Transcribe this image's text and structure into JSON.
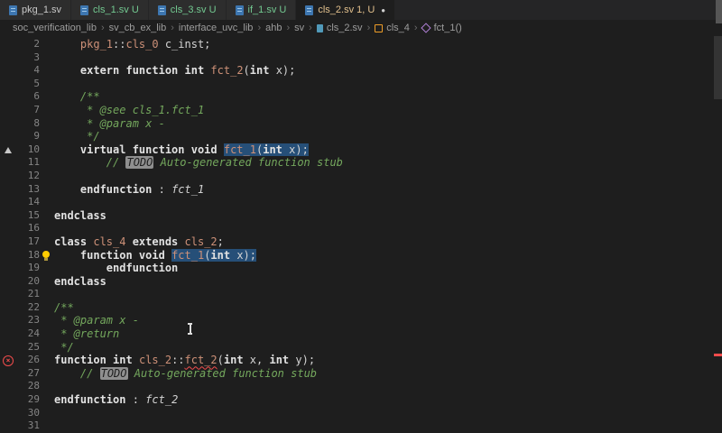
{
  "colors": {
    "editor_background": "#1e1e1e",
    "selection": "#264f78",
    "error": "#f14c4c",
    "lightbulb": "#ffcc00",
    "git_untracked": "#73c991",
    "git_modified": "#e2c08d",
    "type_token": "#ce9178",
    "comment_token": "#74a85d",
    "line_number": "#858585"
  },
  "tabs": [
    {
      "label": "pkg_1.sv",
      "decoration": "",
      "state": "plain",
      "active": false,
      "dirty": false
    },
    {
      "label": "cls_1.sv",
      "decoration": "U",
      "state": "untracked",
      "active": false,
      "dirty": false
    },
    {
      "label": "cls_3.sv",
      "decoration": "U",
      "state": "untracked",
      "active": false,
      "dirty": false
    },
    {
      "label": "if_1.sv",
      "decoration": "U",
      "state": "untracked",
      "active": false,
      "dirty": false
    },
    {
      "label": "cls_2.sv",
      "decoration": "1, U",
      "state": "modified",
      "active": true,
      "dirty": true
    }
  ],
  "breadcrumb": [
    {
      "label": "soc_verification_lib"
    },
    {
      "label": "sv_cb_ex_lib"
    },
    {
      "label": "interface_uvc_lib"
    },
    {
      "label": "ahb"
    },
    {
      "label": "sv"
    },
    {
      "label": "cls_2.sv",
      "icon": "file"
    },
    {
      "label": "cls_4",
      "icon": "class"
    },
    {
      "label": "fct_1()",
      "icon": "method"
    }
  ],
  "editor": {
    "lines": [
      {
        "num": 2,
        "segs": [
          {
            "t": "    ",
            "s": "plain"
          },
          {
            "t": "pkg_1",
            "s": "type"
          },
          {
            "t": "::",
            "s": "plain"
          },
          {
            "t": "cls_0",
            "s": "type"
          },
          {
            "t": " c_inst;",
            "s": "plain"
          }
        ]
      },
      {
        "num": 3,
        "segs": []
      },
      {
        "num": 4,
        "segs": [
          {
            "t": "    ",
            "s": "plain"
          },
          {
            "t": "extern function int",
            "s": "kw"
          },
          {
            "t": " ",
            "s": "plain"
          },
          {
            "t": "fct_2",
            "s": "type"
          },
          {
            "t": "(",
            "s": "plain"
          },
          {
            "t": "int",
            "s": "kw"
          },
          {
            "t": " x);",
            "s": "plain"
          }
        ]
      },
      {
        "num": 5,
        "segs": []
      },
      {
        "num": 6,
        "segs": [
          {
            "t": "    /**",
            "s": "cmt"
          }
        ]
      },
      {
        "num": 7,
        "segs": [
          {
            "t": "     * @see cls_1.fct_1",
            "s": "cmt"
          }
        ]
      },
      {
        "num": 8,
        "segs": [
          {
            "t": "     * @param x -",
            "s": "cmt"
          }
        ]
      },
      {
        "num": 9,
        "segs": [
          {
            "t": "     */",
            "s": "cmt"
          }
        ]
      },
      {
        "num": 10,
        "icon": "triangle",
        "segs": [
          {
            "t": "    ",
            "s": "plain"
          },
          {
            "t": "virtual function void",
            "s": "kw"
          },
          {
            "t": " ",
            "s": "plain"
          },
          {
            "t": "fct_1",
            "s": "type sel"
          },
          {
            "t": "(",
            "s": "plain sel"
          },
          {
            "t": "int",
            "s": "kw sel"
          },
          {
            "t": " x);",
            "s": "plain sel"
          }
        ]
      },
      {
        "num": 11,
        "segs": [
          {
            "t": "        ",
            "s": "plain"
          },
          {
            "t": "// ",
            "s": "cmt"
          },
          {
            "t": "TODO",
            "s": "todo"
          },
          {
            "t": " Auto-generated function stub",
            "s": "cmt"
          }
        ]
      },
      {
        "num": 12,
        "segs": []
      },
      {
        "num": 13,
        "segs": [
          {
            "t": "    ",
            "s": "plain"
          },
          {
            "t": "endfunction",
            "s": "kw"
          },
          {
            "t": " : ",
            "s": "plain"
          },
          {
            "t": "fct_1",
            "s": "lbl"
          }
        ]
      },
      {
        "num": 14,
        "segs": []
      },
      {
        "num": 15,
        "segs": [
          {
            "t": "endclass",
            "s": "kw"
          }
        ]
      },
      {
        "num": 16,
        "segs": []
      },
      {
        "num": 17,
        "segs": [
          {
            "t": "class ",
            "s": "kw"
          },
          {
            "t": "cls_4",
            "s": "type"
          },
          {
            "t": " extends ",
            "s": "kw"
          },
          {
            "t": "cls_2",
            "s": "type"
          },
          {
            "t": ";",
            "s": "plain"
          }
        ]
      },
      {
        "num": 18,
        "icon": "bulb",
        "segs": [
          {
            "t": "    ",
            "s": "plain"
          },
          {
            "t": "function void",
            "s": "kw"
          },
          {
            "t": " ",
            "s": "plain"
          },
          {
            "t": "fct_1",
            "s": "type sel"
          },
          {
            "t": "(",
            "s": "plain sel"
          },
          {
            "t": "int",
            "s": "kw sel"
          },
          {
            "t": " x);",
            "s": "plain sel"
          }
        ]
      },
      {
        "num": 19,
        "segs": [
          {
            "t": "        ",
            "s": "plain"
          },
          {
            "t": "endfunction",
            "s": "kw"
          }
        ]
      },
      {
        "num": 20,
        "segs": [
          {
            "t": "endclass",
            "s": "kw"
          }
        ]
      },
      {
        "num": 21,
        "segs": []
      },
      {
        "num": 22,
        "segs": [
          {
            "t": "/**",
            "s": "cmt"
          }
        ]
      },
      {
        "num": 23,
        "segs": [
          {
            "t": " * @param x -",
            "s": "cmt"
          }
        ]
      },
      {
        "num": 24,
        "segs": [
          {
            "t": " * @return",
            "s": "cmt"
          }
        ]
      },
      {
        "num": 25,
        "segs": [
          {
            "t": " */",
            "s": "cmt"
          }
        ]
      },
      {
        "num": 26,
        "icon": "error",
        "segs": [
          {
            "t": "function int",
            "s": "kw"
          },
          {
            "t": " ",
            "s": "plain"
          },
          {
            "t": "cls_2",
            "s": "type"
          },
          {
            "t": "::",
            "s": "plain"
          },
          {
            "t": "fct_2",
            "s": "type sqg"
          },
          {
            "t": "(",
            "s": "plain"
          },
          {
            "t": "int",
            "s": "kw"
          },
          {
            "t": " x, ",
            "s": "plain"
          },
          {
            "t": "int",
            "s": "kw"
          },
          {
            "t": " y);",
            "s": "plain"
          }
        ]
      },
      {
        "num": 27,
        "segs": [
          {
            "t": "    ",
            "s": "plain"
          },
          {
            "t": "// ",
            "s": "cmt"
          },
          {
            "t": "TODO",
            "s": "todo"
          },
          {
            "t": " Auto-generated function stub",
            "s": "cmt"
          }
        ]
      },
      {
        "num": 28,
        "segs": []
      },
      {
        "num": 29,
        "segs": [
          {
            "t": "endfunction",
            "s": "kw"
          },
          {
            "t": " : ",
            "s": "plain"
          },
          {
            "t": "fct_2",
            "s": "lbl"
          }
        ]
      },
      {
        "num": 30,
        "segs": []
      },
      {
        "num": 31,
        "segs": []
      }
    ]
  }
}
